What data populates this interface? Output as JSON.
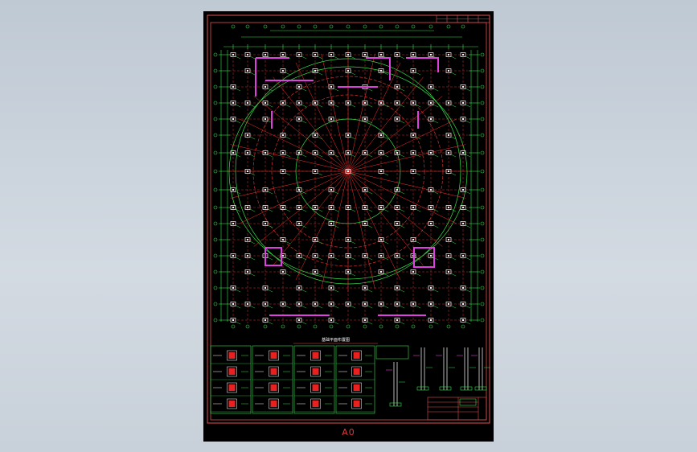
{
  "sheet": {
    "size_label": "A0",
    "plan_caption": "基础平面布置图",
    "background": "#000000"
  },
  "colors": {
    "frame": "#e05050",
    "axis": "#ff3030",
    "dimension": "#36e04a",
    "foundation": "#ffffff",
    "highlight": "#e040e0",
    "page_bg": "#c9d1da"
  }
}
